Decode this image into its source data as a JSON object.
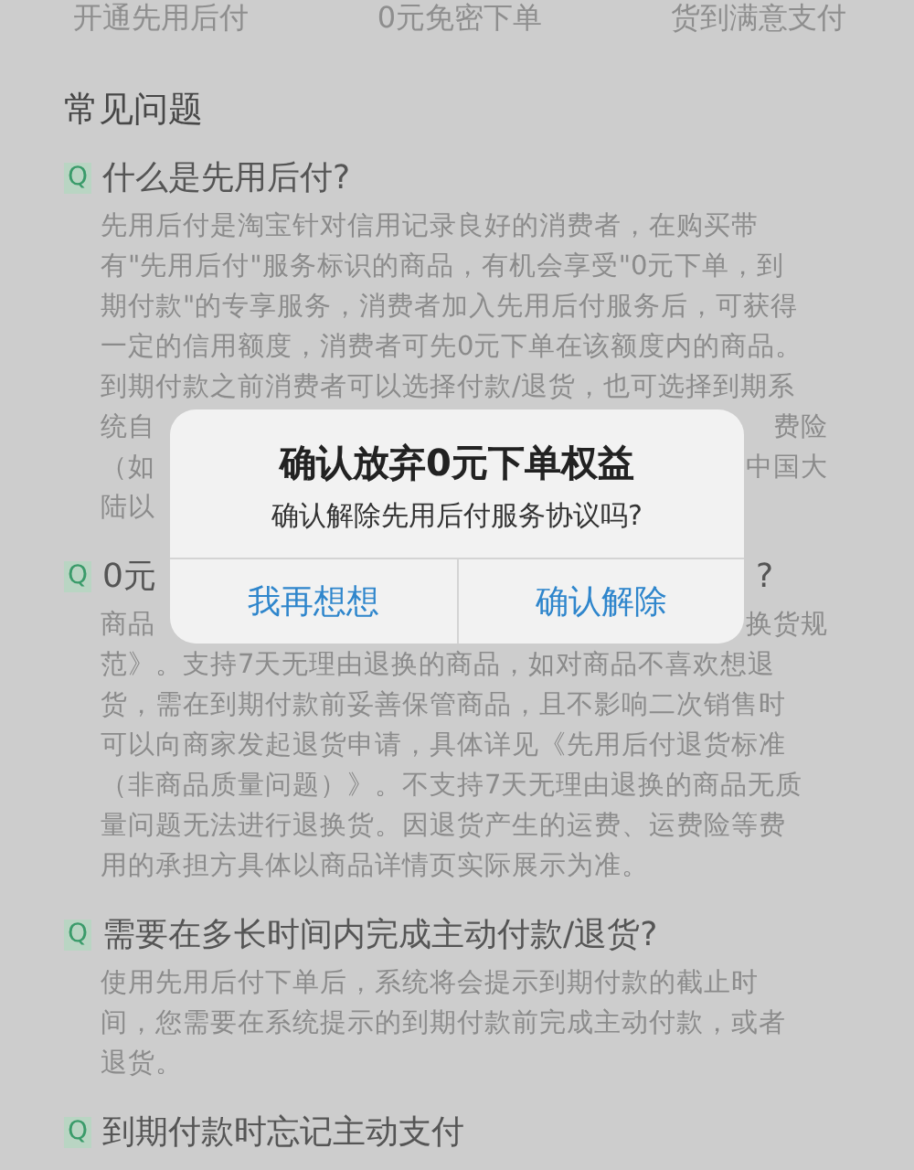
{
  "top_row": [
    "开通先用后付",
    "0元免密下单",
    "货到满意支付"
  ],
  "section_title": "常见问题",
  "faqs": [
    {
      "mark": "Q",
      "question": [
        "什么是先用后付?"
      ],
      "lines": [
        [
          "先用后付是淘宝针对信用记录良好的消费者，在购买带"
        ],
        [
          "有\"先用后付\"服务标识的商品，有机会享受\"0元下单，到"
        ],
        [
          "期付款\"的专享服务，消费者加入先用后付服务后，可获得"
        ],
        [
          "一定的信用额度，消费者可先0元下单在该额度内的商品。"
        ],
        [
          "到期付款之前消费者可以选择付款/退货，也可选择到期系"
        ],
        [
          "统自",
          "费险"
        ],
        [
          "（如",
          "中国大"
        ],
        [
          "陆以"
        ]
      ]
    },
    {
      "mark": "Q",
      "question": [
        "0元",
        "?"
      ],
      "lines": [
        [
          "商品",
          "换货规"
        ],
        [
          "范》。支持7天无理由退换的商品，如对商品不喜欢想退"
        ],
        [
          "货，需在到期付款前妥善保管商品，且不影响二次销售时"
        ],
        [
          "可以向商家发起退货申请，具体详见《先用后付退货标准"
        ],
        [
          "（非商品质量问题）》。不支持7天无理由退换的商品无质"
        ],
        [
          "量问题无法进行退换货。因退货产生的运费、运费险等费"
        ],
        [
          "用的承担方具体以商品详情页实际展示为准。"
        ]
      ]
    },
    {
      "mark": "Q",
      "question": [
        "需要在多长时间内完成主动付款/退货?"
      ],
      "lines": [
        [
          "使用先用后付下单后，系统将会提示到期付款的截止时"
        ],
        [
          "间，您需要在系统提示的到期付款前完成主动付款，或者"
        ],
        [
          "退货。"
        ]
      ]
    },
    {
      "mark": "Q",
      "question": [
        "到期付款时忘记主动支付"
      ]
    }
  ],
  "dialog": {
    "title": "确认放弃0元下单权益",
    "message": "确认解除先用后付服务协议吗?",
    "buttons": [
      {
        "label": "我再想想"
      },
      {
        "label": "确认解除"
      }
    ]
  }
}
